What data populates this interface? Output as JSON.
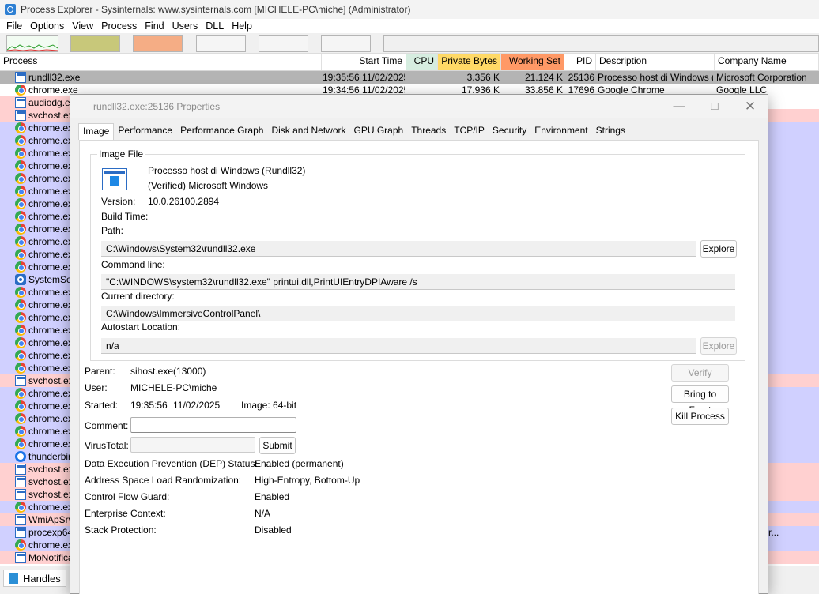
{
  "window": {
    "title": "Process Explorer - Sysinternals: www.sysinternals.com [MICHELE-PC\\miche] (Administrator)"
  },
  "menu": [
    "File",
    "Options",
    "View",
    "Process",
    "Find",
    "Users",
    "DLL",
    "Help"
  ],
  "columns": {
    "process": "Process",
    "start_time": "Start Time",
    "cpu": "CPU",
    "private_bytes": "Private Bytes",
    "working_set": "Working Set",
    "pid": "PID",
    "description": "Description",
    "company": "Company Name"
  },
  "colors": {
    "selected_row": "#b4b4b4",
    "service": "#ffd0d0",
    "own_process": "#d0d0ff",
    "cpu_header": "#d6ede0",
    "private_bytes_header": "#ffd966",
    "working_set_header": "#ff9966"
  },
  "processes": [
    {
      "icon": "window-icon",
      "name": "rundll32.exe",
      "start": "19:35:56 11/02/2025",
      "private": "3.356 K",
      "working": "21.124 K",
      "pid": "25136",
      "desc": "Processo host di Windows (...",
      "company": "Microsoft Corporation"
    },
    {
      "icon": "chrome-icon",
      "name": "chrome.exe",
      "start": "19:34:56 11/02/2025",
      "private": "17.936 K",
      "working": "33.856 K",
      "pid": "17696",
      "desc": "Google Chrome",
      "company": "Google LLC"
    },
    {
      "icon": "window-icon",
      "name": "audiodg.exe",
      "company": "oration"
    },
    {
      "icon": "window-icon",
      "name": "svchost.exe",
      "company": "oration"
    },
    {
      "icon": "chrome-icon",
      "name": "chrome.exe"
    },
    {
      "icon": "chrome-icon",
      "name": "chrome.exe"
    },
    {
      "icon": "chrome-icon",
      "name": "chrome.exe"
    },
    {
      "icon": "chrome-icon",
      "name": "chrome.exe"
    },
    {
      "icon": "chrome-icon",
      "name": "chrome.exe"
    },
    {
      "icon": "chrome-icon",
      "name": "chrome.exe"
    },
    {
      "icon": "chrome-icon",
      "name": "chrome.exe"
    },
    {
      "icon": "chrome-icon",
      "name": "chrome.exe"
    },
    {
      "icon": "chrome-icon",
      "name": "chrome.exe"
    },
    {
      "icon": "chrome-icon",
      "name": "chrome.exe"
    },
    {
      "icon": "chrome-icon",
      "name": "chrome.exe"
    },
    {
      "icon": "chrome-icon",
      "name": "chrome.exe"
    },
    {
      "icon": "gear-icon",
      "name": "SystemSett",
      "company": "oration"
    },
    {
      "icon": "chrome-icon",
      "name": "chrome.exe"
    },
    {
      "icon": "chrome-icon",
      "name": "chrome.exe"
    },
    {
      "icon": "chrome-icon",
      "name": "chrome.exe"
    },
    {
      "icon": "chrome-icon",
      "name": "chrome.exe"
    },
    {
      "icon": "chrome-icon",
      "name": "chrome.exe"
    },
    {
      "icon": "chrome-icon",
      "name": "chrome.exe"
    },
    {
      "icon": "chrome-icon",
      "name": "chrome.exe"
    },
    {
      "icon": "window-icon",
      "name": "svchost.exe",
      "company": "oration"
    },
    {
      "icon": "chrome-icon",
      "name": "chrome.exe"
    },
    {
      "icon": "chrome-icon",
      "name": "chrome.exe"
    },
    {
      "icon": "chrome-icon",
      "name": "chrome.exe"
    },
    {
      "icon": "chrome-icon",
      "name": "chrome.exe"
    },
    {
      "icon": "chrome-icon",
      "name": "chrome.exe"
    },
    {
      "icon": "thunderbird-icon",
      "name": "thunderbird",
      "company": "ation"
    },
    {
      "icon": "window-icon",
      "name": "svchost.exe",
      "company": "oration"
    },
    {
      "icon": "window-icon",
      "name": "svchost.exe",
      "company": "oration"
    },
    {
      "icon": "window-icon",
      "name": "svchost.exe",
      "company": "oration"
    },
    {
      "icon": "chrome-icon",
      "name": "chrome.exe"
    },
    {
      "icon": "window-icon",
      "name": "WmiApSrv.",
      "company": "oration"
    },
    {
      "icon": "window-icon",
      "name": "procexp64.",
      "company": "www.sysinter..."
    },
    {
      "icon": "chrome-icon",
      "name": "chrome.exe"
    },
    {
      "icon": "window-icon",
      "name": "MoNotificat",
      "company": "oration"
    }
  ],
  "bottom_tab": "Handles",
  "dialog": {
    "title": "rundll32.exe:25136 Properties",
    "tabs": [
      "Image",
      "Performance",
      "Performance Graph",
      "Disk and Network",
      "GPU Graph",
      "Threads",
      "TCP/IP",
      "Security",
      "Environment",
      "Strings"
    ],
    "image_file_label": "Image File",
    "description": "Processo host di Windows (Rundll32)",
    "verified": "(Verified) Microsoft Windows",
    "version_label": "Version:",
    "version": "10.0.26100.2894",
    "build_time_label": "Build Time:",
    "path_label": "Path:",
    "path": "C:\\Windows\\System32\\rundll32.exe",
    "explore_label": "Explore",
    "command_line_label": "Command line:",
    "command_line": "\"C:\\WINDOWS\\system32\\rundll32.exe\" printui.dll,PrintUIEntryDPIAware /s",
    "current_dir_label": "Current directory:",
    "current_dir": "C:\\Windows\\ImmersiveControlPanel\\",
    "autostart_label": "Autostart Location:",
    "autostart": "n/a",
    "parent_label": "Parent:",
    "parent": "sihost.exe(13000)",
    "user_label": "User:",
    "user": "MICHELE-PC\\miche",
    "started_label": "Started:",
    "started_time": "19:35:56",
    "started_date": "11/02/2025",
    "image_bits": "Image: 64-bit",
    "comment_label": "Comment:",
    "virustotal_label": "VirusTotal:",
    "submit_label": "Submit",
    "verify_label": "Verify",
    "bring_front_label": "Bring to Front",
    "kill_label": "Kill Process",
    "dep_label": "Data Execution Prevention (DEP) Status:",
    "dep": "Enabled (permanent)",
    "aslr_label": "Address Space Load Randomization:",
    "aslr": "High-Entropy, Bottom-Up",
    "cfg_label": "Control Flow Guard:",
    "cfg": "Enabled",
    "enterprise_label": "Enterprise Context:",
    "enterprise": "N/A",
    "stack_label": "Stack Protection:",
    "stack": "Disabled"
  }
}
